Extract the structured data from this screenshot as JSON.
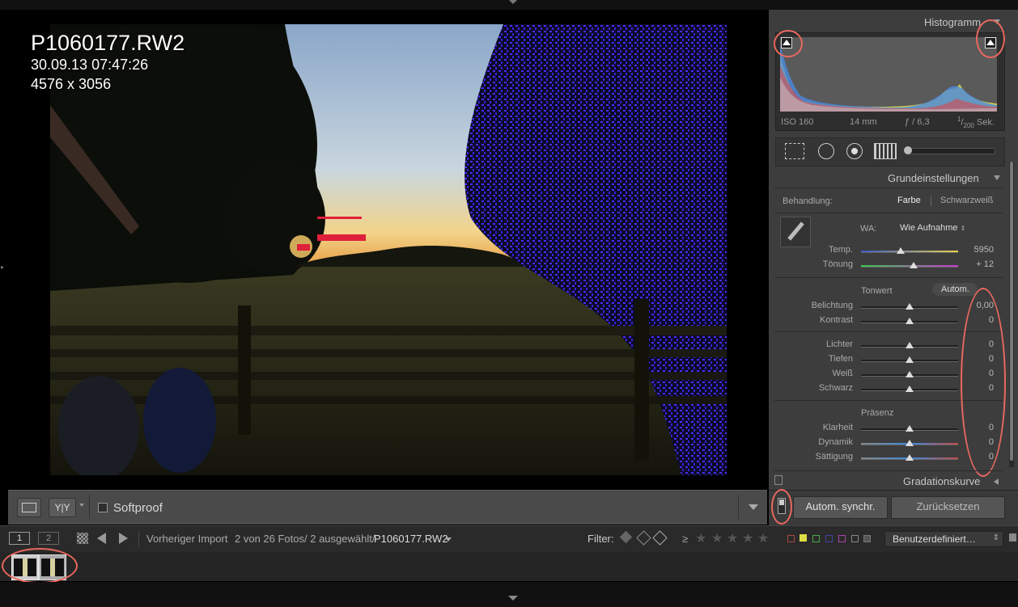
{
  "photo_info": {
    "filename": "P1060177.RW2",
    "datetime": "30.09.13 07:47:26",
    "dimensions": "4576 x 3056"
  },
  "toolbar": {
    "view_label_yy": "Y|Y",
    "softproof_label": "Softproof"
  },
  "histogram": {
    "title": "Histogramm",
    "iso": "ISO 160",
    "focal": "14 mm",
    "aperture": "ƒ / 6,3",
    "shutter_num": "1",
    "shutter_den": "200",
    "shutter_unit": "Sek."
  },
  "basic": {
    "title": "Grundeinstellungen",
    "treatment_label": "Behandlung:",
    "treatment_color": "Farbe",
    "treatment_bw": "Schwarzweiß",
    "wb_label": "WA:",
    "wb_value": "Wie Aufnahme",
    "sliders_wb": [
      {
        "label": "Temp.",
        "value": "5950",
        "pos": 0.41
      },
      {
        "label": "Tönung",
        "value": "+ 12",
        "pos": 0.54
      }
    ],
    "tone_title": "Tonwert",
    "auto_label": "Autom.",
    "sliders_tone": [
      {
        "label": "Belichtung",
        "value": "0,00",
        "pos": 0.5
      },
      {
        "label": "Kontrast",
        "value": "0",
        "pos": 0.5
      }
    ],
    "sliders_light": [
      {
        "label": "Lichter",
        "value": "0",
        "pos": 0.5
      },
      {
        "label": "Tiefen",
        "value": "0",
        "pos": 0.5
      },
      {
        "label": "Weiß",
        "value": "0",
        "pos": 0.5
      },
      {
        "label": "Schwarz",
        "value": "0",
        "pos": 0.5
      }
    ],
    "presence_title": "Präsenz",
    "sliders_presence": [
      {
        "label": "Klarheit",
        "value": "0",
        "pos": 0.5
      },
      {
        "label": "Dynamik",
        "value": "0",
        "pos": 0.5
      },
      {
        "label": "Sättigung",
        "value": "0",
        "pos": 0.5
      }
    ]
  },
  "curve_title": "Gradationskurve",
  "actions": {
    "sync_label": "Autom. synchr.",
    "reset_label": "Zurücksetzen"
  },
  "filmbar": {
    "view1": "1",
    "view2": "2",
    "source": "Vorheriger Import",
    "count": "2 von 26 Fotos/ 2 ausgewählt/",
    "current_file": "P1060177.RW2",
    "filter_label": "Filter:",
    "ge_symbol": "≥",
    "preset": "Benutzerdefiniert…"
  },
  "colors": {
    "annotation_ring": "#e8685f",
    "clip_blue": "#4a2cff",
    "clip_red": "#e0203a"
  }
}
